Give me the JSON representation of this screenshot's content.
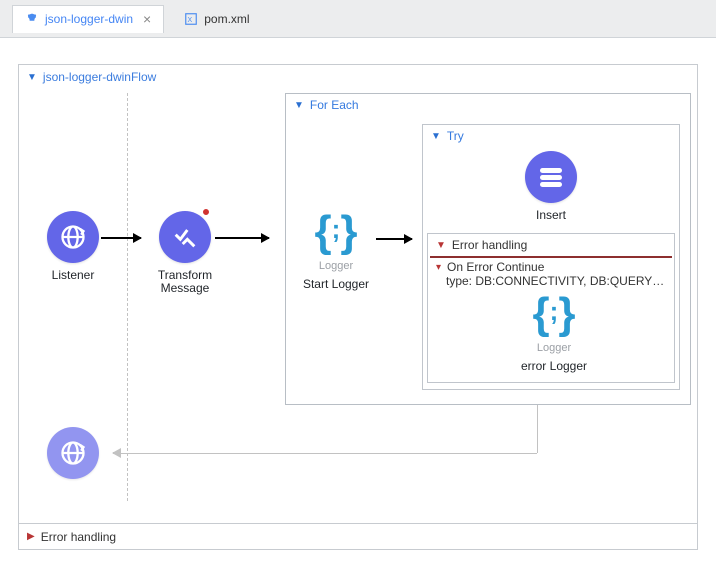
{
  "tabs": [
    {
      "label": "json-logger-dwin",
      "active": true,
      "closeable": true
    },
    {
      "label": "pom.xml",
      "active": false,
      "closeable": false
    }
  ],
  "flow": {
    "name": "json-logger-dwinFlow",
    "nodes": {
      "listener": {
        "title": "Listener"
      },
      "transform": {
        "title": "Transform Message"
      },
      "startLogger": {
        "sub": "Logger",
        "title": "Start Logger"
      },
      "insert": {
        "title": "Insert"
      },
      "errorLogger": {
        "sub": "Logger",
        "title": "error Logger"
      }
    },
    "scopes": {
      "forEach": "For Each",
      "try": "Try",
      "errorHandling": "Error handling",
      "onErrorContinue": "On Error Continue",
      "errorType": "type: DB:CONNECTIVITY, DB:QUERY_EXEC..."
    },
    "bottom": {
      "errorHandling": "Error handling"
    }
  }
}
